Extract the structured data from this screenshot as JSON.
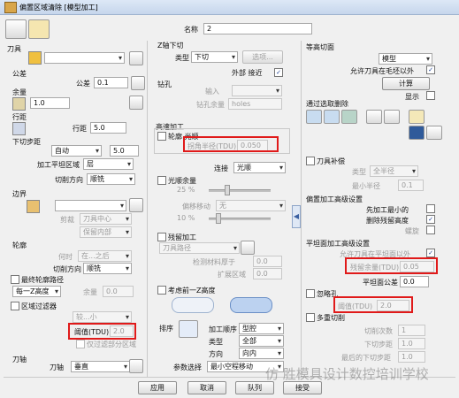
{
  "window": {
    "title": "偏置区域清除 [模型加工]"
  },
  "name": {
    "label": "名称",
    "value": "2"
  },
  "left": {
    "tool_label": "刀具",
    "tolerance_group": "公差",
    "tolerance_label": "公差",
    "tolerance_value": "0.1",
    "allowance_label": "余量",
    "allowance_value": "1.0",
    "stepover_group": "行距",
    "stepover_label": "行距",
    "stepover_value": "5.0",
    "stepdown_group": "下切步距",
    "stepdown_mode": "自动",
    "stepdown_value": "5.0",
    "flat_label": "加工平坦区域",
    "flat_value": "层",
    "cut_dir_label": "切削方向",
    "cut_dir_value": "顺铣",
    "boundary_group": "边界",
    "boundary_clip_label": "剪裁",
    "boundary_clip_value": "刀具中心",
    "boundary_keep_value": "保留内部",
    "profile_group": "轮廓",
    "profile_order_label": "何时",
    "profile_order_value": "在...之后",
    "profile_cut_dir_label": "切削方向",
    "profile_cut_dir_value": "顺铣",
    "final_profile_label": "最终轮廓路径",
    "final_profile_allowance_label": "余量",
    "final_profile_allowance_value": "0.0",
    "each_z_value": "每一Z高度",
    "region_filter_label": "区域过滤器",
    "region_filter_mode": "较...小",
    "threshold_label": "阈值(TDU)",
    "threshold_value": "2.0",
    "filter_only_label": "仅过滤部分区域",
    "tool_axis_group": "刀轴",
    "tool_axis_label": "刀轴",
    "tool_axis_value": "垂直"
  },
  "middle": {
    "z_plunge_group": "Z轴下切",
    "type_label": "类型",
    "type_value": "下切",
    "select_btn": "选项...",
    "outer_label": "外部 接近",
    "drill_group": "钻孔",
    "drill_input_label": "输入",
    "drill_allowance_label": "钻孔余量",
    "drill_holes_value": "holes",
    "hsm_group": "高速加工",
    "smoothing_label": "轮廓 光顺",
    "corner_radius_label": "拐角半径(TDU)",
    "corner_radius_value": "0.050",
    "link_label": "连接",
    "link_value": "光顺",
    "smooth_allowance_label": "光顺余量",
    "smooth_allowance_pct": "25 %",
    "offset_label": "偏移移动",
    "offset_value": "无",
    "offset_pct": "10 %",
    "rest_group": "残留加工",
    "rest_tool_label": "刀具路径",
    "rest_thicker_label": "检测材料厚于",
    "rest_thicker_value": "0.0",
    "rest_expand_label": "扩展区域",
    "rest_expand_value": "0.0",
    "previous_z_label": "考虑前一Z高度",
    "sort_label": "排序",
    "order_label": "加工顺序",
    "order_value": "型腔",
    "type2_label": "类型",
    "type2_value": "全部",
    "direction_label": "方向",
    "direction_value": "向内",
    "param_label": "参数选择",
    "param_value": "最小空程移动"
  },
  "right": {
    "contour_group": "等高切面",
    "contour_mode": "模型",
    "allow_outside_label": "允许刀具在毛坯以外",
    "calc_btn": "计算",
    "show_label": "显示",
    "select_remove_label": "通过选取删除",
    "tool_comp_label": "刀具补偿",
    "comp_type_label": "类型",
    "comp_type_value": "全半径",
    "comp_min_radius_label": "最小半径",
    "comp_min_radius_value": "0.1",
    "offset_settings_group": "偏置加工高级设置",
    "machine_first_label": "先加工最小的",
    "remove_slivers_label": "删除残留高度",
    "spiral_label": "螺旋",
    "flat_settings_group": "平坦面加工高级设置",
    "allow_outside_flat_label": "允许刀具在平坦面以外",
    "flat_allowance_label": "残留余量(TDU)",
    "flat_allowance_value": "0.05",
    "flat_tol_label": "平坦面公差",
    "flat_tol_value": "0.0",
    "ignore_holes_label": "忽略孔",
    "ignore_threshold_label": "阈值(TDU)",
    "ignore_threshold_value": "2.0",
    "multi_cut_label": "多重切削",
    "cut_count_label": "切削次数",
    "cut_count_value": "1",
    "down_step_label": "下切步距",
    "down_step_value": "1.0",
    "max_down_step_label": "最后的下切步距",
    "max_down_step_value": "1.0"
  },
  "buttons": {
    "apply": "应用",
    "cancel": "取消",
    "queue": "队列",
    "accept": "接受"
  },
  "watermark": "仿 胜模具设计数控培训学校"
}
